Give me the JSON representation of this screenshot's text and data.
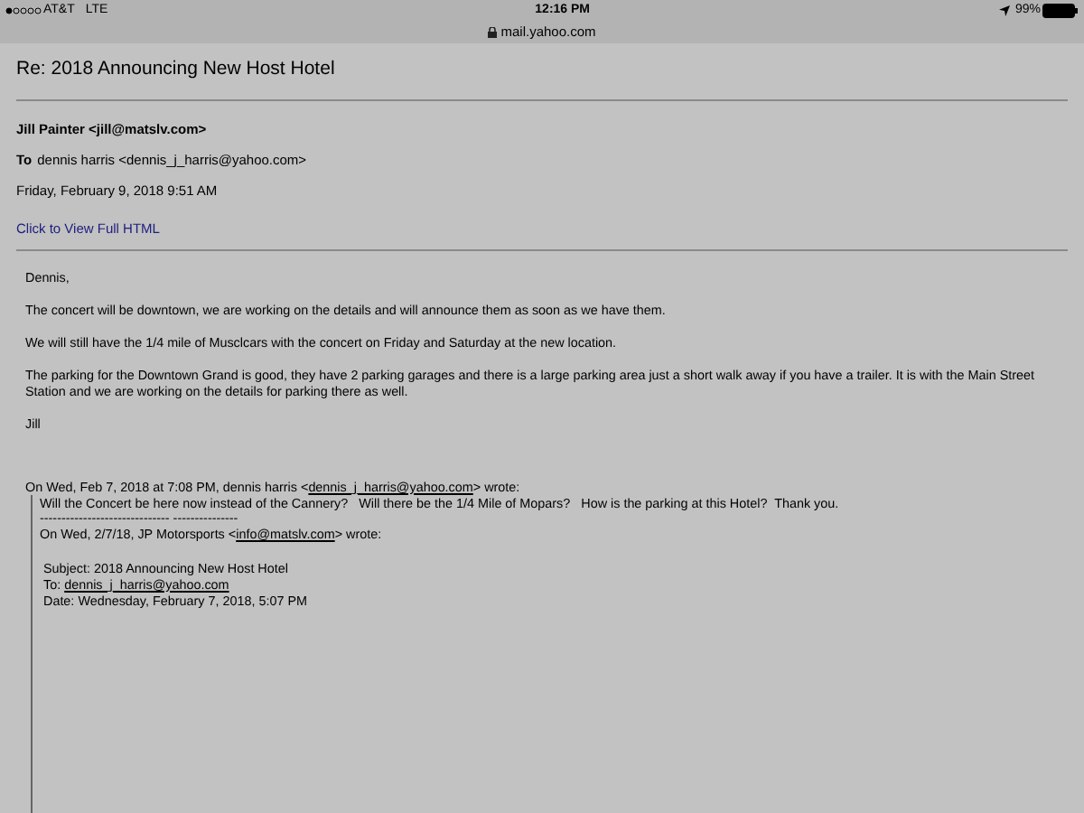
{
  "status_bar": {
    "carrier": "AT&T",
    "network": "LTE",
    "time": "12:16 PM",
    "url": "mail.yahoo.com",
    "battery": "99%"
  },
  "email": {
    "subject": "Re: 2018 Announcing New Host Hotel",
    "from": "Jill Painter <jill@matslv.com>",
    "to_label": "To",
    "to": "dennis harris <dennis_j_harris@yahoo.com>",
    "date": "Friday, February 9, 2018 9:51 AM",
    "link": "Click to View Full HTML"
  },
  "body": [
    "Dennis,",
    "The concert will be downtown, we are working on the details and will announce them as soon as we have them.",
    "We will still have the 1/4 mile of Musclcars with the concert on Friday and Saturday at the new location.",
    "The parking for the Downtown Grand is good, they have 2 parking garages and there is a large parking area just a short walk away if you have a trailer. It is with the Main Street Station and we are working on the details for parking there as well.",
    "Jill"
  ],
  "quote": {
    "header": {
      "before": "On Wed, Feb 7, 2018 at 7:08 PM, dennis harris <",
      "link": "dennis_j_harris@yahoo.com",
      "after": "> wrote:"
    },
    "message": "Will the Concert be here now instead of the Cannery?   Will there be the 1/4 Mile of Mopars?   How is the parking at this Hotel?  Thank you.",
    "separator": "------------------------------ ---------------",
    "inner_header": {
      "before": "On Wed, 2/7/18, JP Motorsports <",
      "link": "info@matslv.com",
      "after": "> wrote:"
    },
    "fields": [
      {
        "label": "Subject:",
        "value": "2018 Announcing New Host Hotel",
        "is_link": false
      },
      {
        "label": "To:",
        "value": "dennis_j_harris@yahoo.com",
        "is_link": true
      },
      {
        "label": "Date:",
        "value": "Wednesday, February 7, 2018, 5:07 PM",
        "is_link": false
      }
    ]
  }
}
